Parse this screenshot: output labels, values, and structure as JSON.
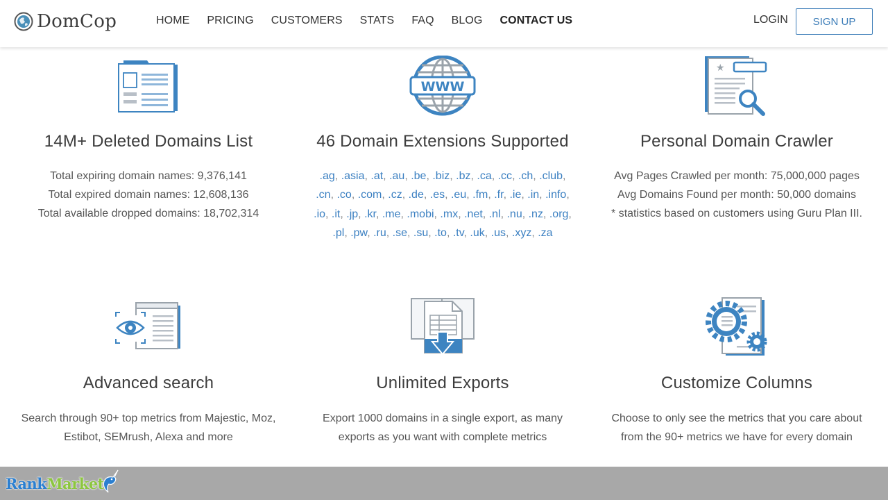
{
  "header": {
    "logo_text": "DomCop",
    "nav": [
      {
        "label": "HOME"
      },
      {
        "label": "PRICING"
      },
      {
        "label": "CUSTOMERS"
      },
      {
        "label": "STATS"
      },
      {
        "label": "FAQ"
      },
      {
        "label": "BLOG"
      },
      {
        "label": "CONTACT US",
        "active": true
      }
    ],
    "login": "LOGIN",
    "signup": "SIGN UP"
  },
  "features": {
    "deleted": {
      "title": "14M+ Deleted Domains List",
      "lines": [
        "Total expiring domain names: 9,376,141",
        "Total expired domain names: 12,608,136",
        "Total available dropped domains: 18,702,314"
      ]
    },
    "extensions": {
      "title": "46 Domain Extensions Supported",
      "items": [
        ".ag",
        ".asia",
        ".at",
        ".au",
        ".be",
        ".biz",
        ".bz",
        ".ca",
        ".cc",
        ".ch",
        ".club",
        ".cn",
        ".co",
        ".com",
        ".cz",
        ".de",
        ".es",
        ".eu",
        ".fm",
        ".fr",
        ".ie",
        ".in",
        ".info",
        ".io",
        ".it",
        ".jp",
        ".kr",
        ".me",
        ".mobi",
        ".mx",
        ".net",
        ".nl",
        ".nu",
        ".nz",
        ".org",
        ".pl",
        ".pw",
        ".ru",
        ".se",
        ".su",
        ".to",
        ".tv",
        ".uk",
        ".us",
        ".xyz",
        ".za"
      ]
    },
    "crawler": {
      "title": "Personal Domain Crawler",
      "lines": [
        "Avg Pages Crawled per month: 75,000,000 pages",
        "Avg Domains Found per month: 50,000 domains",
        "* statistics based on customers using Guru Plan III."
      ]
    },
    "search": {
      "title": "Advanced search",
      "lines": [
        "Search through 90+ top metrics from Majestic, Moz,",
        "Estibot, SEMrush, Alexa and more"
      ]
    },
    "exports": {
      "title": "Unlimited Exports",
      "lines": [
        "Export 1000 domains in a single export, as many",
        "exports as you want with complete metrics"
      ]
    },
    "columns": {
      "title": "Customize Columns",
      "lines": [
        "Choose to only see the metrics that you care about",
        "from the 90+ metrics we have for every domain"
      ]
    }
  },
  "icons": {
    "logo": "domcop-globe-icon",
    "deleted": "document-list-icon",
    "extensions": "www-globe-icon",
    "crawler": "document-search-icon",
    "search": "eye-browser-icon",
    "exports": "export-download-icon",
    "columns": "gear-settings-icon"
  },
  "watermark": {
    "text_a": "Rank",
    "text_b": "Market"
  },
  "colors": {
    "accent": "#3a7bb7",
    "link": "#3a7fc1",
    "icon_blue": "#3d84c1",
    "footer": "#a8a8a8"
  }
}
